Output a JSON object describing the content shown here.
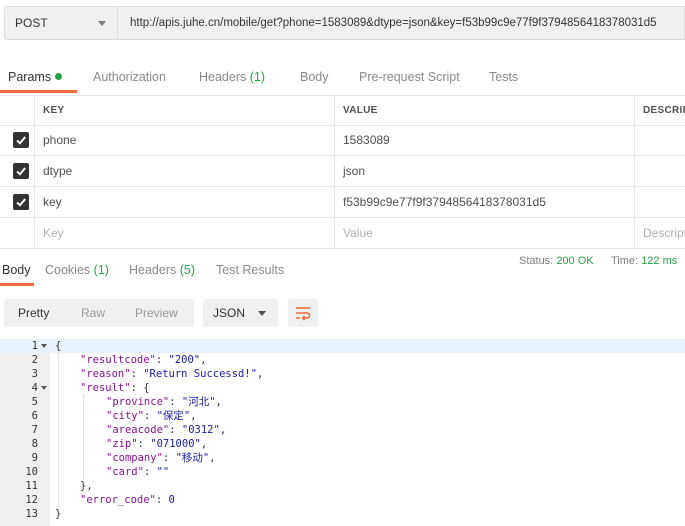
{
  "request": {
    "method": "POST",
    "url": "http://apis.juhe.cn/mobile/get?phone=1583089&dtype=json&key=f53b99c9e77f9f3794856418378031d5"
  },
  "request_tabs": {
    "params": "Params",
    "authorization": "Authorization",
    "headers": "Headers",
    "headers_count": "(1)",
    "body": "Body",
    "prerequest": "Pre-request Script",
    "tests": "Tests"
  },
  "params_table": {
    "col_key": "KEY",
    "col_value": "VALUE",
    "col_desc": "DESCRIPTION",
    "rows": [
      {
        "key": "phone",
        "value": "1583089"
      },
      {
        "key": "dtype",
        "value": "json"
      },
      {
        "key": "key",
        "value": "f53b99c9e77f9f3794856418378031d5"
      }
    ],
    "key_placeholder": "Key",
    "value_placeholder": "Value",
    "desc_placeholder": "Description"
  },
  "response_tabs": {
    "body": "Body",
    "cookies": "Cookies",
    "cookies_count": "(1)",
    "headers": "Headers",
    "headers_count": "(5)",
    "test_results": "Test Results"
  },
  "response_status": {
    "status_label": "Status:",
    "status_value": "200 OK",
    "time_label": "Time:",
    "time_value": "122 ms"
  },
  "response_view": {
    "pretty": "Pretty",
    "raw": "Raw",
    "preview": "Preview",
    "format": "JSON"
  },
  "response_body": {
    "line_numbers": [
      "1",
      "2",
      "3",
      "4",
      "5",
      "6",
      "7",
      "8",
      "9",
      "10",
      "11",
      "12",
      "13"
    ],
    "l1": "{",
    "l2_key": "\"resultcode\"",
    "l2_val": "\"200\"",
    "l3_key": "\"reason\"",
    "l3_val": "\"Return Successd!\"",
    "l4_key": "\"result\"",
    "l5_key": "\"province\"",
    "l5_val": "\"河北\"",
    "l6_key": "\"city\"",
    "l6_val": "\"保定\"",
    "l7_key": "\"areacode\"",
    "l7_val": "\"0312\"",
    "l8_key": "\"zip\"",
    "l8_val": "\"071000\"",
    "l9_key": "\"company\"",
    "l9_val": "\"移动\"",
    "l10_key": "\"card\"",
    "l10_val": "\"\"",
    "l11": "},",
    "l12_key": "\"error_code\"",
    "l12_val": "0",
    "l13": "}"
  },
  "colors": {
    "accent": "#f26b3a",
    "success": "#26a245",
    "json_key": "#881391",
    "json_value": "#1a1aa6"
  }
}
